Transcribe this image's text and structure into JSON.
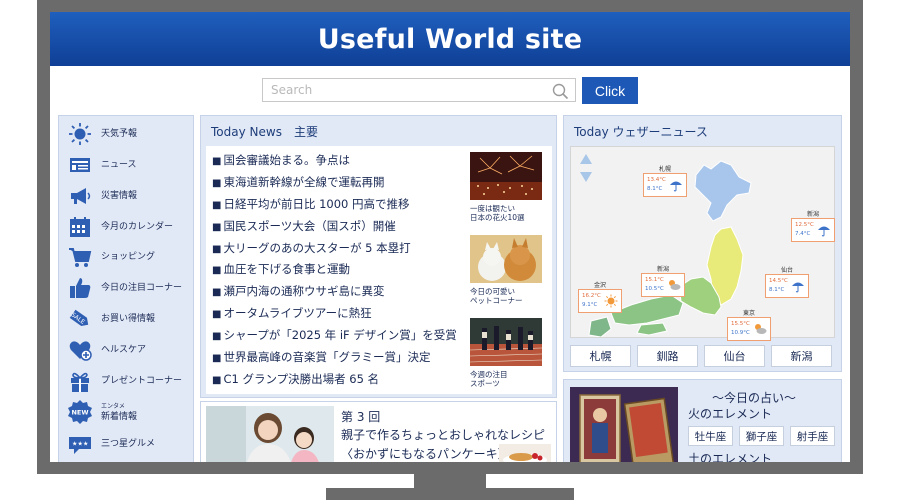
{
  "site": {
    "title": "Useful World site"
  },
  "search": {
    "placeholder": "Search",
    "button": "Click"
  },
  "sidebar": {
    "items": [
      {
        "label": "天気予報",
        "icon": "sun-icon"
      },
      {
        "label": "ニュース",
        "icon": "newspaper-icon"
      },
      {
        "label": "災害情報",
        "icon": "megaphone-icon"
      },
      {
        "label": "今月のカレンダー",
        "icon": "calendar-icon"
      },
      {
        "label": "ショッピング",
        "icon": "cart-icon"
      },
      {
        "label": "今日の注目コーナー",
        "icon": "thumbs-up-icon"
      },
      {
        "label": "お買い得情報",
        "icon": "sale-tag-icon",
        "badge": "SALE"
      },
      {
        "label": "ヘルスケア",
        "icon": "heart-plus-icon"
      },
      {
        "label": "プレゼントコーナー",
        "icon": "gift-icon"
      },
      {
        "label": "新着情報",
        "sublabel": "エンタメ",
        "icon": "new-badge-icon",
        "badge": "NEW"
      },
      {
        "label": "三つ星グルメ",
        "icon": "three-stars-icon"
      }
    ]
  },
  "news": {
    "title": "Today News　主要",
    "headlines": [
      "国会審議始まる。争点は",
      "東海道新幹線が全線で運転再開",
      "日経平均が前日比 1000 円高で推移",
      "国民スポーツ大会（国スポ）開催",
      "大リーグのあの大スターが 5 本塁打",
      "血圧を下げる食事と運動",
      "瀬戸内海の通称ウサギ島に異変",
      "オータムライブツアーに熱狂",
      "シャープが「2025 年 iF デザイン賞」を受賞",
      "世界最高峰の音楽賞「グラミー賞」決定",
      "C1 グランプ決勝出場者 65 名"
    ],
    "features": [
      {
        "caption_l1": "一度は観たい",
        "caption_l2": "日本の花火10選",
        "image": "fireworks"
      },
      {
        "caption_l1": "今日の可愛い",
        "caption_l2": "ペットコーナー",
        "image": "cat-and-dog"
      },
      {
        "caption_l1": "今週の注目",
        "caption_l2": "スポーツ",
        "image": "running-race"
      }
    ]
  },
  "recipe": {
    "episode": "第 3 回",
    "title": "親子で作るちょっとおしゃれなレシピ",
    "subtitle": "〈おかずにもなるパンケーキ〉"
  },
  "weather": {
    "title": "Today ウェザーニュース",
    "cities": [
      {
        "name": "札幌",
        "hi": "13.4°C",
        "lo": "8.1°C",
        "icon": "umbrella-icon"
      },
      {
        "name": "新潟",
        "hi": "12.5°C",
        "lo": "7.4°C",
        "icon": "umbrella-icon"
      },
      {
        "name": "仙台",
        "hi": "14.5°C",
        "lo": "8.1°C",
        "icon": "umbrella-icon"
      },
      {
        "name": "金沢",
        "hi": "16.2°C",
        "lo": "9.1°C",
        "icon": "sun-icon"
      },
      {
        "name": "新潟",
        "hi": "15.1°C",
        "lo": "10.5°C",
        "icon": "cloud-sun-icon"
      },
      {
        "name": "東京",
        "hi": "15.5°C",
        "lo": "10.9°C",
        "icon": "cloud-sun-icon"
      }
    ],
    "buttons": [
      "札幌",
      "釧路",
      "仙台",
      "新潟"
    ]
  },
  "fortune": {
    "heading": "〜今日の占い〜",
    "element1": "火のエレメント",
    "signs": [
      "牡牛座",
      "獅子座",
      "射手座"
    ],
    "element2": "土のエレメント"
  },
  "colors": {
    "header": "#1d56b3",
    "accent": "#1d58b6",
    "panel": "#e2e9f6",
    "text": "#1a2a55"
  }
}
